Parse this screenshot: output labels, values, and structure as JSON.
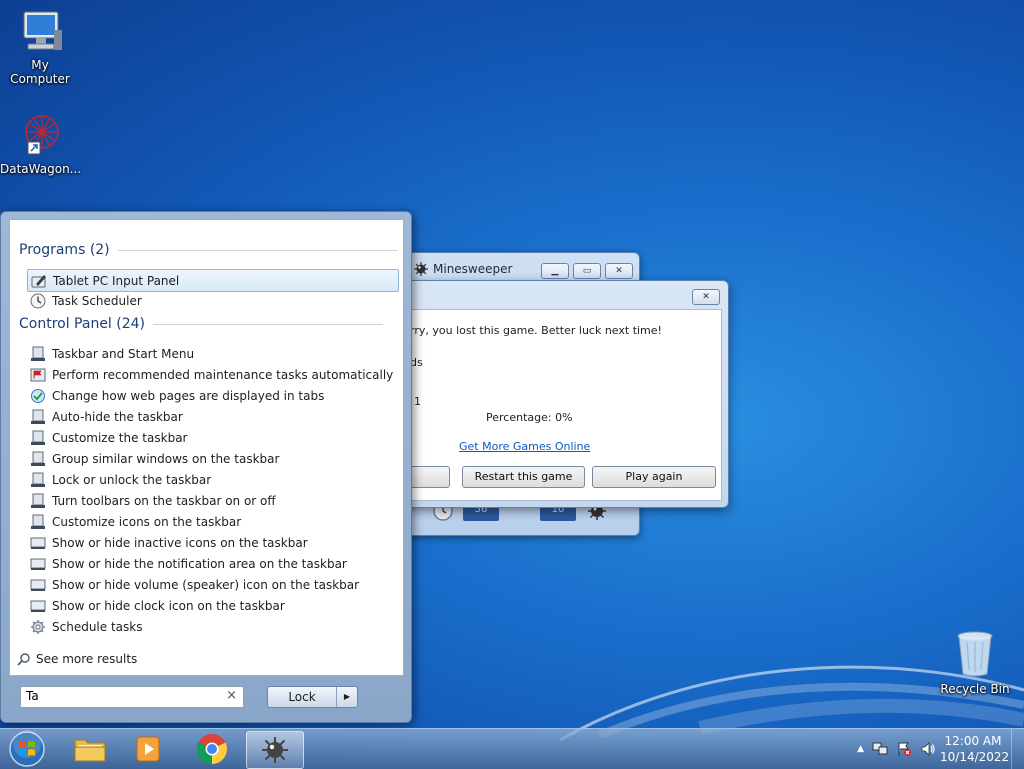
{
  "desktop": {
    "icons": [
      {
        "label": "My Computer"
      },
      {
        "label": "DataWagon..."
      },
      {
        "label": "Recycle Bin"
      }
    ]
  },
  "minesweeper": {
    "title": "Minesweeper",
    "time_counter": "56",
    "mine_counter": "10"
  },
  "dialog": {
    "message": "rry, you lost this game. Better luck next time!",
    "stat_line_1": "ds",
    "stat_line_2": "1",
    "percentage": "Percentage: 0%",
    "link": "Get More Games Online",
    "restart_button": "Restart this game",
    "play_again_button": "Play again"
  },
  "start_menu": {
    "programs_header": "Programs (2)",
    "programs": [
      {
        "label": "Tablet PC Input Panel",
        "icon": "pen-tablet-icon",
        "selected": true
      },
      {
        "label": "Task Scheduler",
        "icon": "clock-icon"
      }
    ],
    "control_panel_header": "Control Panel (24)",
    "control_panel": [
      {
        "label": "Taskbar and Start Menu",
        "icon": "taskbar-icon"
      },
      {
        "label": "Perform recommended maintenance tasks automatically",
        "icon": "flag-icon"
      },
      {
        "label": "Change how web pages are displayed in tabs",
        "icon": "internet-options-icon"
      },
      {
        "label": "Auto-hide the taskbar",
        "icon": "taskbar-icon"
      },
      {
        "label": "Customize the taskbar",
        "icon": "taskbar-icon"
      },
      {
        "label": "Group similar windows on the taskbar",
        "icon": "taskbar-icon"
      },
      {
        "label": "Lock or unlock the taskbar",
        "icon": "taskbar-icon"
      },
      {
        "label": "Turn toolbars on the taskbar on or off",
        "icon": "taskbar-icon"
      },
      {
        "label": "Customize icons on the taskbar",
        "icon": "taskbar-icon"
      },
      {
        "label": "Show or hide inactive icons on the taskbar",
        "icon": "notification-area-icon"
      },
      {
        "label": "Show or hide the notification area on the taskbar",
        "icon": "notification-area-icon"
      },
      {
        "label": "Show or hide volume (speaker) icon on the taskbar",
        "icon": "notification-area-icon"
      },
      {
        "label": "Show or hide clock icon on the taskbar",
        "icon": "notification-area-icon"
      },
      {
        "label": "Schedule tasks",
        "icon": "admin-tools-icon"
      }
    ],
    "see_more": "See more results",
    "search_value": "Ta",
    "lock_button": "Lock"
  },
  "taskbar": {
    "time": "12:00 AM",
    "date": "10/14/2022"
  }
}
